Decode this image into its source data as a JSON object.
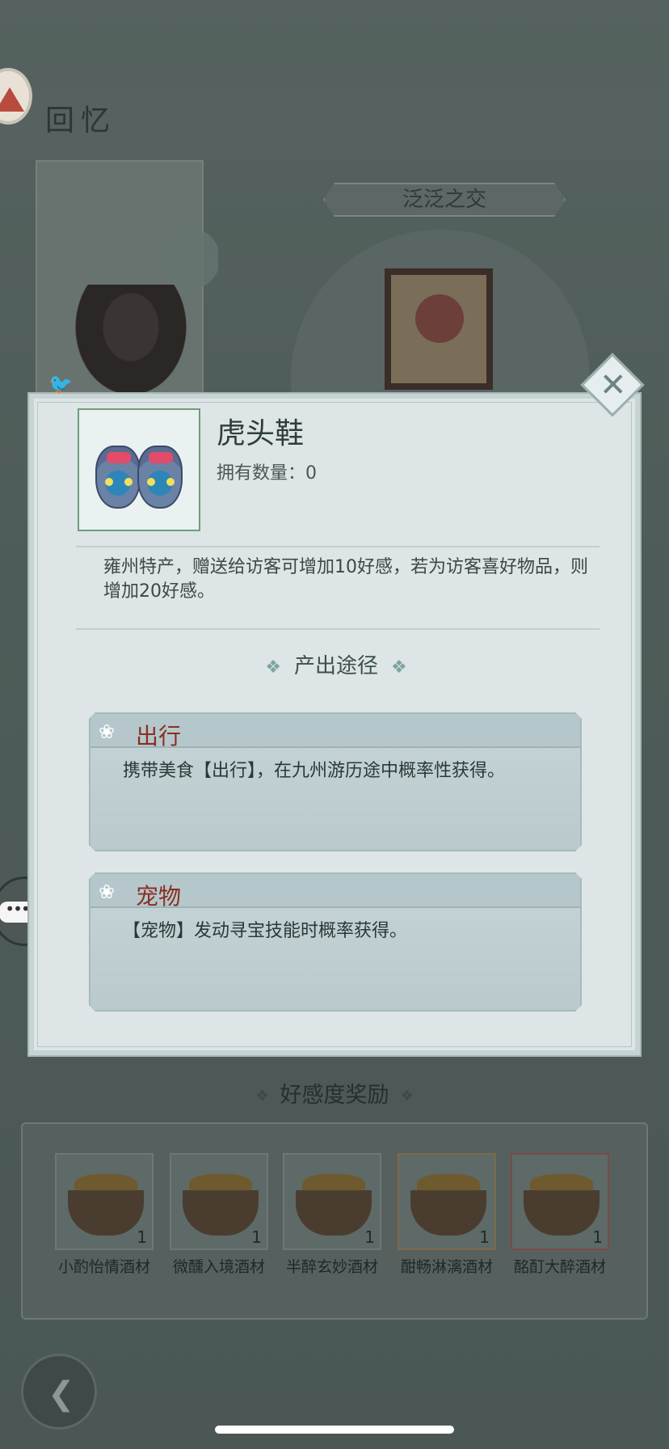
{
  "background": {
    "title": "回忆",
    "level_tag": "泛泛之交",
    "rewards_title": "好感度奖励",
    "rewards": [
      {
        "label": "小酌怡情酒材",
        "count": "1"
      },
      {
        "label": "微醺入境酒材",
        "count": "1"
      },
      {
        "label": "半醉玄妙酒材",
        "count": "1"
      },
      {
        "label": "酣畅淋漓酒材",
        "count": "1"
      },
      {
        "label": "酩酊大醉酒材",
        "count": "1"
      }
    ]
  },
  "modal": {
    "item_name": "虎头鞋",
    "item_count_label": "拥有数量：0",
    "description": "雍州特产，赠送给访客可增加10好感，若为访客喜好物品，则增加20好感。",
    "sources_title": "产出途径",
    "sources": [
      {
        "name": "出行",
        "text": "携带美食【出行】，在九州游历途中概率性获得。"
      },
      {
        "name": "宠物",
        "text": "【宠物】发动寻宝技能时概率获得。"
      }
    ]
  },
  "icons": {
    "close": "close-icon",
    "lotus": "lotus-icon",
    "back": "back-arrow-icon",
    "chat": "chat-icon"
  }
}
